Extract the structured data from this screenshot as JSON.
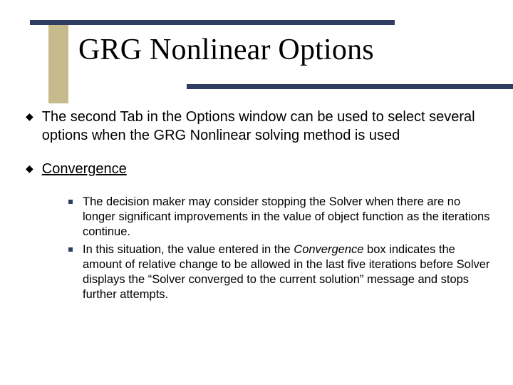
{
  "title": "GRG Nonlinear Options",
  "bullets": [
    {
      "text": "The second Tab in the Options window can be used to select several options when the GRG Nonlinear solving method is used"
    },
    {
      "text": "Convergence"
    }
  ],
  "sub": [
    {
      "text": "The decision maker may consider stopping the Solver when there are no longer significant improvements in the value of object function as the iterations continue."
    },
    {
      "pre": "In this situation, the value entered in the ",
      "ital": "Convergence ",
      "post": "box indicates the amount of relative change to be allowed in the last five iterations before Solver displays the “Solver converged to the current solution” message and stops further attempts."
    }
  ]
}
